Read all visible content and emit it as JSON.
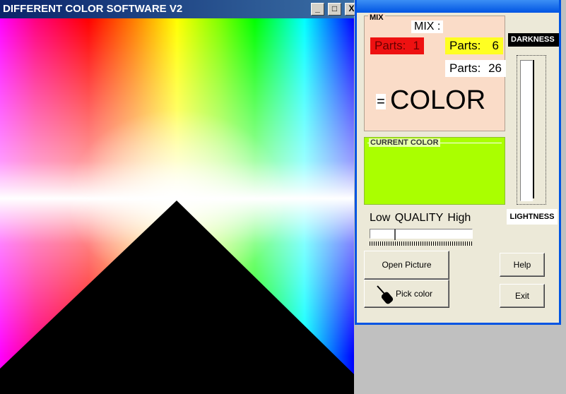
{
  "picture_window": {
    "title": "DIFFERENT COLOR SOFTWARE  V2",
    "buttons": {
      "minimize": "_",
      "maximize": "□",
      "close": "X"
    }
  },
  "mix_panel": {
    "caption": "MIX",
    "title": "MIX :",
    "parts": [
      {
        "label": "Parts:",
        "value": "1",
        "color": "#ee1111"
      },
      {
        "label": "Parts:",
        "value": "6",
        "color": "#ffff22"
      },
      {
        "label": "Parts:",
        "value": "26",
        "color": "#ffffff"
      }
    ],
    "equals": "=",
    "result_word": "COLOR"
  },
  "current_color": {
    "caption": "CURRENT COLOR",
    "value": "#aaff00"
  },
  "darkness_label": "DARKNESS",
  "lightness_label": "LIGHTNESS",
  "quality": {
    "label": "Low  QUALITY  High",
    "level": 0.25
  },
  "buttons": {
    "open_picture": "Open Picture",
    "pick_color": "Pick color",
    "help": "Help",
    "exit": "Exit"
  },
  "icons": {
    "pick_color": "eyedropper-icon"
  }
}
